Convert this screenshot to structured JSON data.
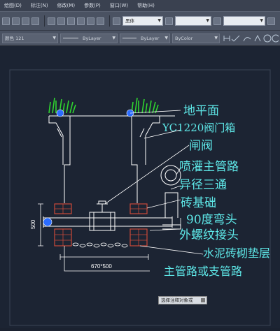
{
  "menu": {
    "items": [
      "绘图(D)",
      "标注(N)",
      "修改(M)",
      "参数(P)",
      "窗口(W)",
      "帮助(H)"
    ]
  },
  "toolbar": {
    "font_name": "黑体",
    "layer": "颜色 121",
    "linetype1": "ByLayer",
    "linetype2": "ByLayer",
    "color": "ByColor"
  },
  "drawing": {
    "labels": [
      "地平面",
      "YC1220阀门箱",
      "闸阀",
      "喷灌主管路",
      "异径三通",
      "砖基础",
      "90度弯头",
      "外螺纹接头",
      "水泥砖砌垫层",
      "主管路或支管路"
    ],
    "dim_width": "670*500",
    "dim_height": "500"
  },
  "tooltip": {
    "text": "选择注释对象或"
  },
  "colors": {
    "label": "#5ee8e8",
    "lines": "#ffffff",
    "grass": "#2fd42f",
    "brick": "#c94a3a",
    "pipe": "#2b6cff"
  }
}
